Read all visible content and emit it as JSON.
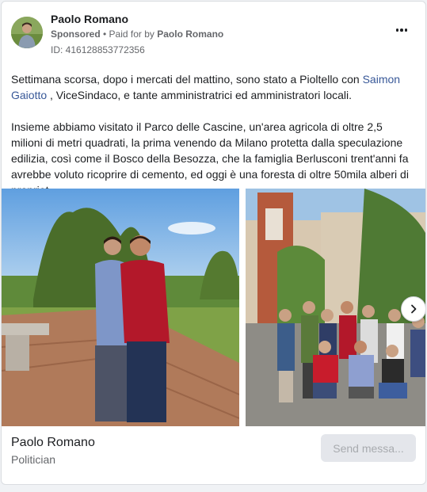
{
  "advertiser": {
    "name": "Paolo Romano",
    "sponsored_label": "Sponsored",
    "paid_for_prefix": " • Paid for by ",
    "paid_for_name": "Paolo Romano",
    "ad_id": "ID: 416128853772356"
  },
  "body": {
    "p1_before": "Settimana scorsa, dopo i mercati del mattino, sono stato a Pioltello con ",
    "p1_link": "Saimon Gaiotto",
    "p1_after": " , ViceSindaco, e tante amministratrici ed amministratori locali.",
    "p2": "Insieme abbiamo visitato il Parco delle Cascine, un'area agricola di oltre 2,5 milioni di metri quadrati, la prima venendo da Milano protetta dalla speculazione edilizia, così come il Bosco della Besozza, che la famiglia Berlusconi trent'anni fa avrebbe voluto ricoprire di cemento, ed oggi è una foresta di oltre 50mila alberi di propriet..."
  },
  "carousel": {
    "next_icon": "chevron-right-icon"
  },
  "footer": {
    "title": "Paolo Romano",
    "subtitle": "Politician",
    "cta_label": "Send messa..."
  },
  "colors": {
    "link": "#385898",
    "muted": "#65676b",
    "cta_bg": "#e4e6eb",
    "cta_text": "#a8abaf"
  }
}
